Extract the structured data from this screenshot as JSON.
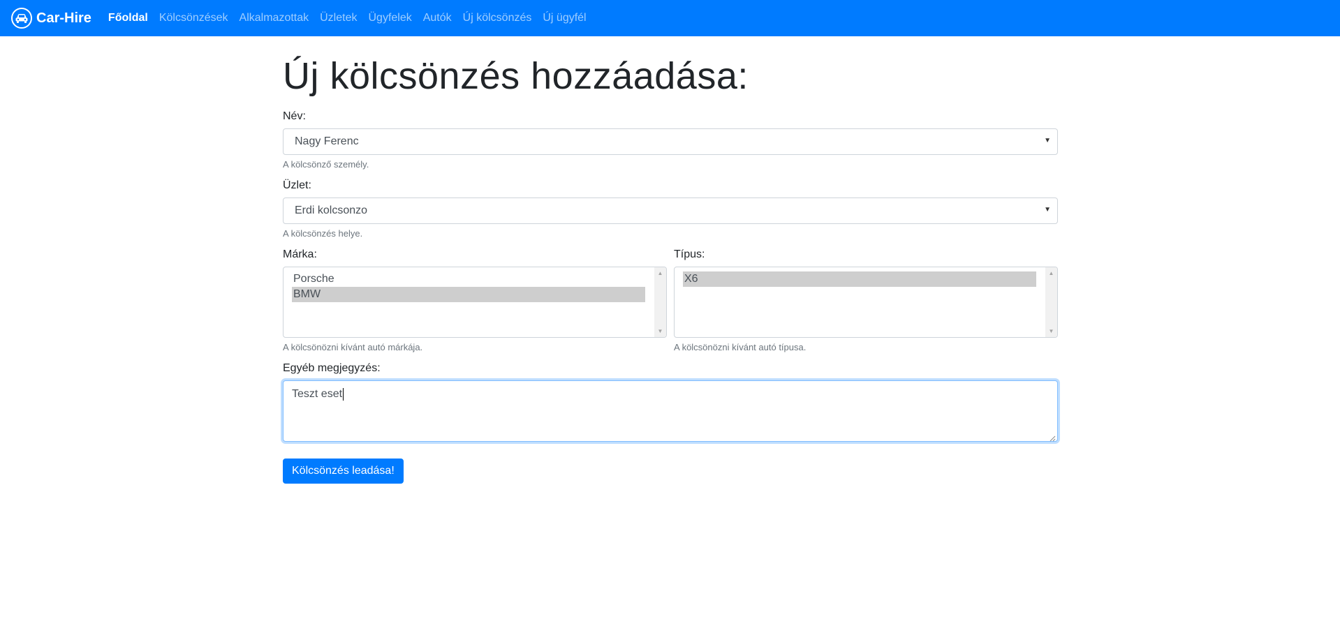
{
  "navbar": {
    "brand": "Car-Hire",
    "brand_icon": "car-icon",
    "bg_color": "#007bff",
    "links": [
      {
        "label": "Főoldal",
        "active": true
      },
      {
        "label": "Kölcsönzések",
        "active": false
      },
      {
        "label": "Alkalmazottak",
        "active": false
      },
      {
        "label": "Üzletek",
        "active": false
      },
      {
        "label": "Ügyfelek",
        "active": false
      },
      {
        "label": "Autók",
        "active": false
      },
      {
        "label": "Új kölcsönzés",
        "active": false
      },
      {
        "label": "Új ügyfél",
        "active": false
      }
    ]
  },
  "page": {
    "title": "Új kölcsönzés hozzáadása:"
  },
  "form": {
    "name": {
      "label": "Név:",
      "value": "Nagy Ferenc",
      "help": "A kölcsönző személy."
    },
    "shop": {
      "label": "Üzlet:",
      "value": "Erdi kolcsonzo",
      "help": "A kölcsönzés helye."
    },
    "brand": {
      "label": "Márka:",
      "options": [
        "Porsche",
        "BMW"
      ],
      "selected": "BMW",
      "help": "A kölcsönözni kívánt autó márkája."
    },
    "type": {
      "label": "Típus:",
      "options": [
        "X6"
      ],
      "selected": "X6",
      "help": "A kölcsönözni kívánt autó típusa."
    },
    "note": {
      "label": "Egyéb megjegyzés:",
      "value": "Teszt eset"
    },
    "submit_label": "Kölcsönzés leadása!"
  }
}
